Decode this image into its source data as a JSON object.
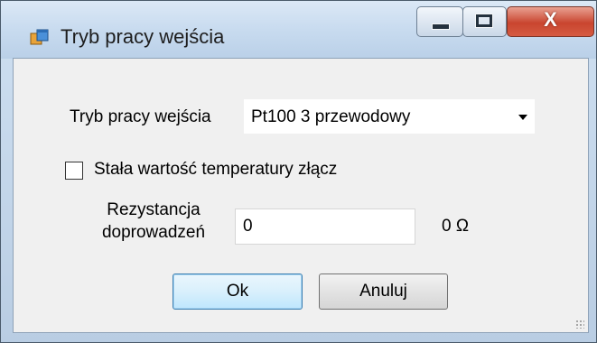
{
  "window": {
    "title": "Tryb pracy wejścia",
    "close_glyph": "X"
  },
  "form": {
    "mode_label": "Tryb pracy wejścia",
    "mode_value": "Pt100 3 przewodowy",
    "constant_temp_label": "Stała wartość temperatury złącz",
    "constant_temp_checked": false,
    "resistance_label_line1": "Rezystancja",
    "resistance_label_line2": "doprowadzeń",
    "resistance_value": "0",
    "resistance_unit": "0 Ω"
  },
  "buttons": {
    "ok_label": "Ok",
    "cancel_label": "Anuluj"
  },
  "icons": {
    "app": "window-app-icon",
    "minimize": "minimize-icon",
    "maximize": "maximize-icon",
    "close": "close-icon",
    "dropdown": "chevron-down-icon"
  }
}
